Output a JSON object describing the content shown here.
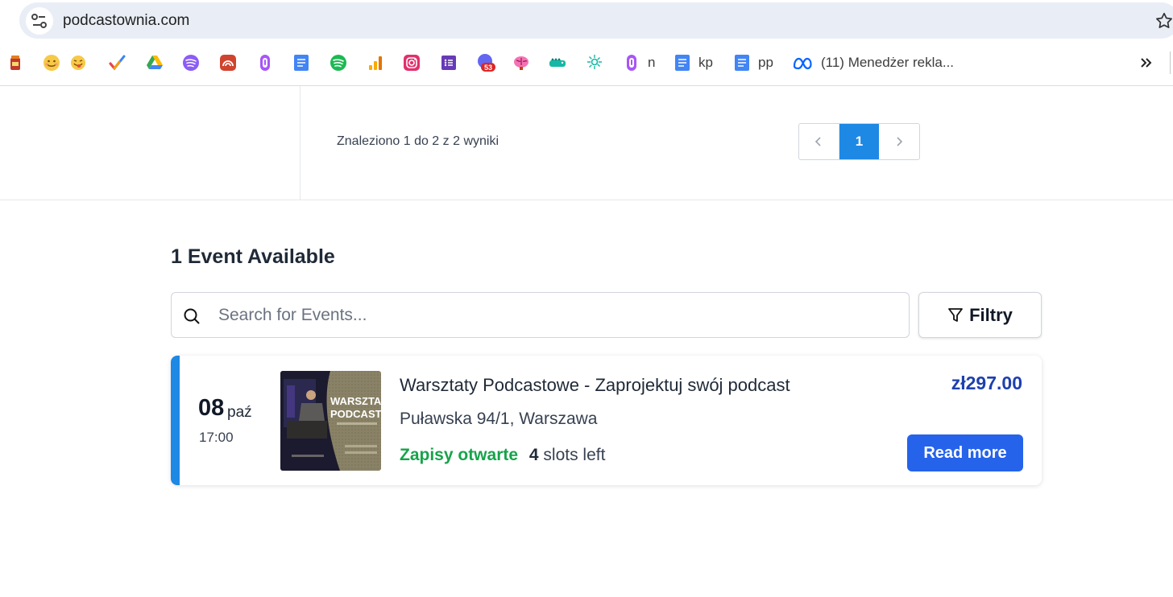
{
  "browser": {
    "url": "podcastownia.com",
    "bookmarks": [
      {
        "icon": "jar-icon",
        "label": ""
      },
      {
        "icon": "smiley-icon",
        "label": ""
      },
      {
        "icon": "tongue-emoji-icon",
        "label": ""
      },
      {
        "icon": "checkmark-icon",
        "label": ""
      },
      {
        "icon": "google-drive-icon",
        "label": ""
      },
      {
        "icon": "spotify-purple-icon",
        "label": ""
      },
      {
        "icon": "podcast-red-icon",
        "label": ""
      },
      {
        "icon": "podcasts-purple-icon",
        "label": ""
      },
      {
        "icon": "google-docs-icon",
        "label": ""
      },
      {
        "icon": "spotify-icon",
        "label": ""
      },
      {
        "icon": "analytics-icon",
        "label": ""
      },
      {
        "icon": "instagram-icon",
        "label": ""
      },
      {
        "icon": "forms-icon",
        "label": ""
      },
      {
        "icon": "notification-badge-icon",
        "label": "",
        "badge": "53"
      },
      {
        "icon": "brain-icon",
        "label": ""
      },
      {
        "icon": "crocodile-icon",
        "label": ""
      },
      {
        "icon": "sparkle-icon",
        "label": ""
      },
      {
        "icon": "podcasts-purple-icon",
        "label": "n"
      },
      {
        "icon": "google-docs-icon",
        "label": "kp"
      },
      {
        "icon": "google-docs-icon",
        "label": "pp"
      },
      {
        "icon": "meta-icon",
        "label": "(11) Menedżer rekla..."
      }
    ]
  },
  "results": {
    "summary": "Znaleziono 1 do 2 z 2 wyniki",
    "current_page": "1"
  },
  "events": {
    "heading": "1 Event Available",
    "search_placeholder": "Search for Events...",
    "filter_label": "Filtry",
    "items": [
      {
        "day": "08",
        "month": "paź",
        "time": "17:00",
        "thumbnail_text": "WARSZTATY PODCASTO",
        "title": "Warsztaty Podcastowe - Zaprojektuj swój podcast",
        "address": "Puławska 94/1, Warszawa",
        "status": "Zapisy otwarte",
        "slots_count": "4",
        "slots_label": "slots left",
        "price": "zł297.00",
        "cta": "Read more"
      }
    ]
  },
  "colors": {
    "accent": "#1e88e5",
    "cta": "#2563eb",
    "price": "#1e40af",
    "status_open": "#16a34a"
  }
}
